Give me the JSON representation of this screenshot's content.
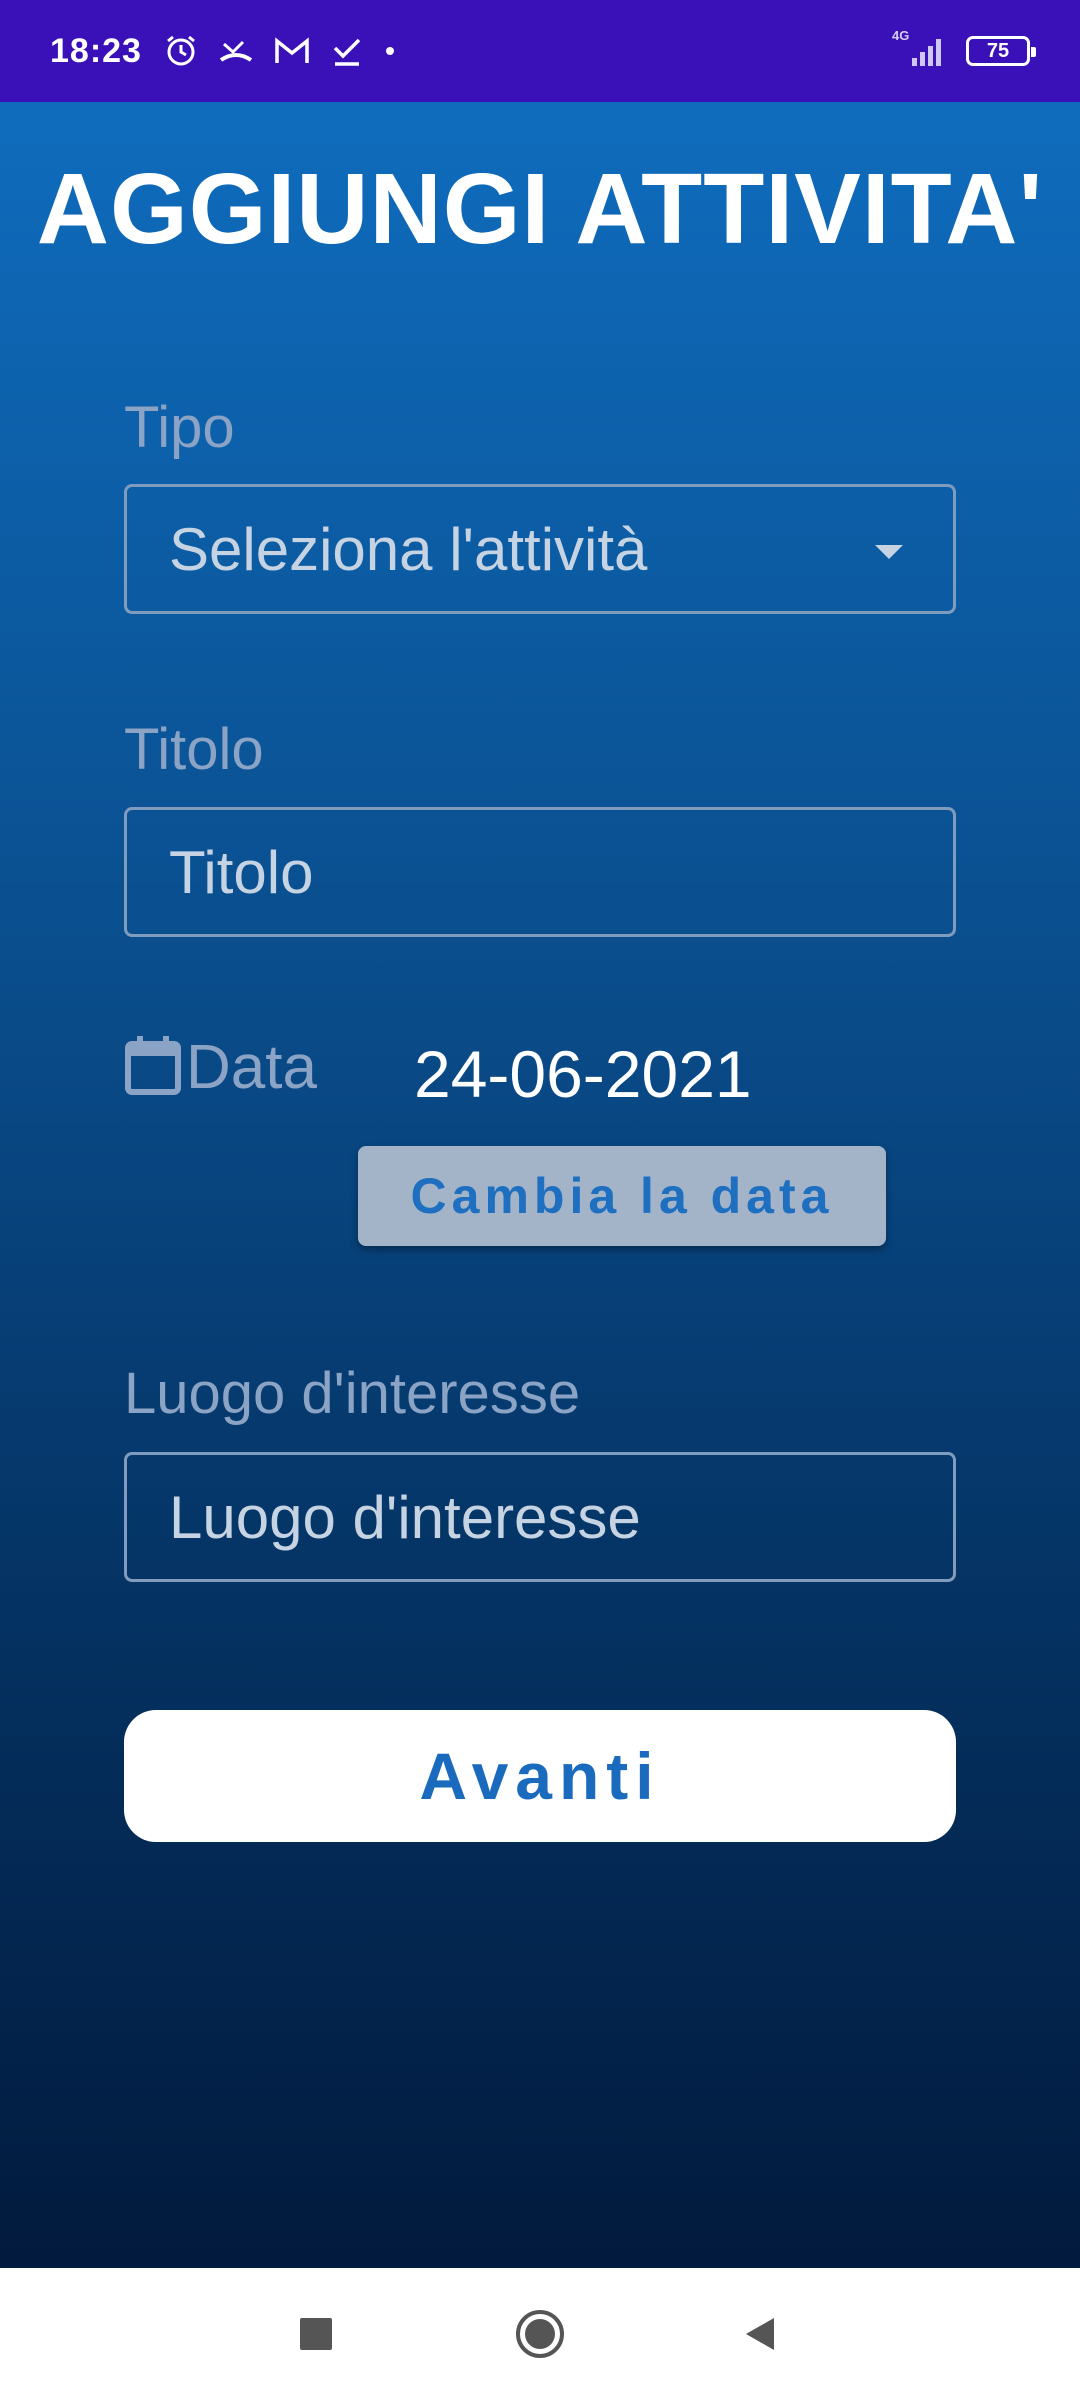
{
  "status_bar": {
    "time": "18:23",
    "network": "4G",
    "battery": "75",
    "icons": [
      "alarm-icon",
      "missed-call-icon",
      "gmail-icon",
      "task-check-icon",
      "dot-icon",
      "signal-icon",
      "battery-icon"
    ]
  },
  "page": {
    "title": "AGGIUNGI ATTIVITA'"
  },
  "form": {
    "tipo": {
      "label": "Tipo",
      "selected": "Seleziona l'attività"
    },
    "titolo": {
      "label": "Titolo",
      "placeholder": "Titolo"
    },
    "data": {
      "label": "Data",
      "value": "24-06-2021",
      "change_button": "Cambia la data"
    },
    "luogo": {
      "label": "Luogo d'interesse",
      "placeholder": "Luogo d'interesse"
    },
    "next_button": "Avanti"
  },
  "nav_bar": {
    "icons": [
      "recents-square-icon",
      "home-circle-icon",
      "back-triangle-icon"
    ]
  },
  "colors": {
    "status_bar": "#3a10b8",
    "gradient_top": "#0f6cbd",
    "gradient_bottom": "#021a3d",
    "accent_blue": "#1a6bbd",
    "secondary_button": "#a3b4c9"
  }
}
